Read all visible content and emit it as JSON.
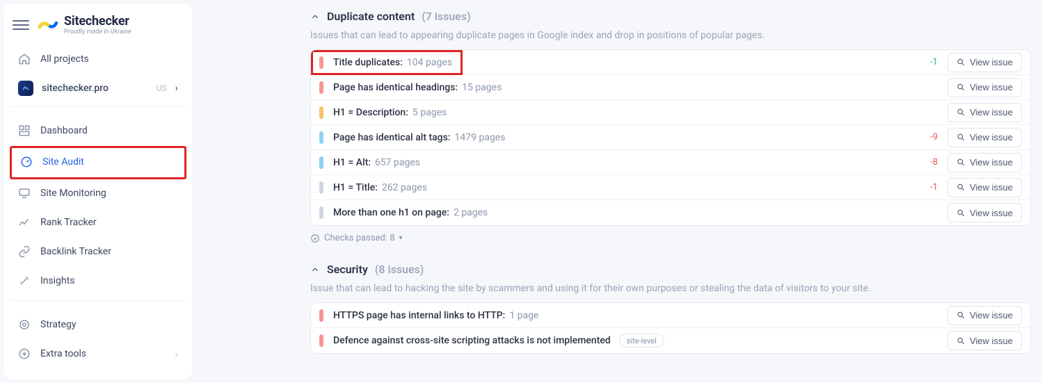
{
  "brand": {
    "name": "Sitechecker",
    "sub": "Proudly made in Ukraine"
  },
  "sidebar": {
    "all_projects": "All projects",
    "project": {
      "name": "sitechecker.pro",
      "badge": "US"
    },
    "items": [
      {
        "label": "Dashboard"
      },
      {
        "label": "Site Audit"
      },
      {
        "label": "Site Monitoring"
      },
      {
        "label": "Rank Tracker"
      },
      {
        "label": "Backlink Tracker"
      },
      {
        "label": "Insights"
      }
    ],
    "bottom": [
      {
        "label": "Strategy"
      },
      {
        "label": "Extra tools"
      }
    ]
  },
  "sections": [
    {
      "title": "Duplicate content",
      "count_text": "(7 issues)",
      "desc": "Issues that can lead to appearing duplicate pages in Google index and drop in positions of popular pages.",
      "highlight_first": true,
      "issues": [
        {
          "pill": "red",
          "label": "Title duplicates:",
          "count": "104 pages",
          "delta": "-1",
          "delta_class": "delta-green"
        },
        {
          "pill": "red",
          "label": "Page has identical headings:",
          "count": "15 pages"
        },
        {
          "pill": "orange",
          "label": "H1 = Description:",
          "count": "5 pages"
        },
        {
          "pill": "blue",
          "label": "Page has identical alt tags:",
          "count": "1479 pages",
          "delta": "-9",
          "delta_class": "delta-red"
        },
        {
          "pill": "blue",
          "label": "H1 = Alt:",
          "count": "657 pages",
          "delta": "-8",
          "delta_class": "delta-red"
        },
        {
          "pill": "gray",
          "label": "H1 = Title:",
          "count": "262 pages",
          "delta": "-1",
          "delta_class": "delta-red"
        },
        {
          "pill": "gray",
          "label": "More than one h1 on page:",
          "count": "2 pages"
        }
      ],
      "checks_passed": "Checks passed: 8"
    },
    {
      "title": "Security",
      "count_text": "(8 issues)",
      "desc": "Issue that can lead to hacking the site by scammers and using it for their own purposes or stealing the data of visitors to your site.",
      "issues": [
        {
          "pill": "red",
          "label": "HTTPS page has internal links to HTTP:",
          "count": "1 page"
        },
        {
          "pill": "red",
          "label": "Defence against cross-site scripting attacks is not implemented",
          "badge": "site-level"
        }
      ]
    }
  ],
  "view_issue_label": "View issue"
}
